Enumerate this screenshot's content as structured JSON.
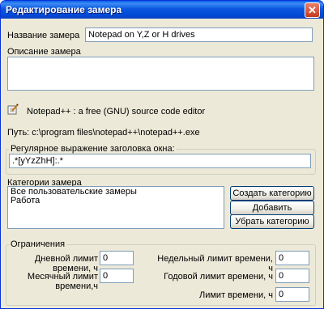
{
  "window": {
    "title": "Редактирование замера",
    "close_glyph": "✕"
  },
  "name_field": {
    "label": "Название замера",
    "value": "Notepad on Y,Z or H drives"
  },
  "description_field": {
    "label": "Описание замера",
    "value": ""
  },
  "app_info": {
    "title": "Notepad++ : a free (GNU) source code editor",
    "icon": "pencil-notepad-icon"
  },
  "path": {
    "text": "Путь: c:\\program files\\notepad++\\notepad++.exe"
  },
  "regex_field": {
    "label": "Регулярное выражение заголовка окна:",
    "value": ".*[yYzZhH]:.*"
  },
  "categories": {
    "label": "Категории замера",
    "items": [
      "Все пользовательские замеры",
      "Работа"
    ],
    "create_button": "Создать категорию",
    "add_button": "Добавить категорию",
    "remove_button": "Убрать категорию"
  },
  "limits": {
    "title": "Ограничения",
    "daily_label": "Дневной лимит времени, ч",
    "daily_value": "0",
    "weekly_label": "Недельный лимит времени, ч",
    "weekly_value": "0",
    "monthly_label": "Месячный лимит времени,ч",
    "monthly_value": "0",
    "yearly_label": "Годовой лимит времени, ч",
    "yearly_value": "0",
    "total_label": "Лимит времени, ч",
    "total_value": "0"
  }
}
